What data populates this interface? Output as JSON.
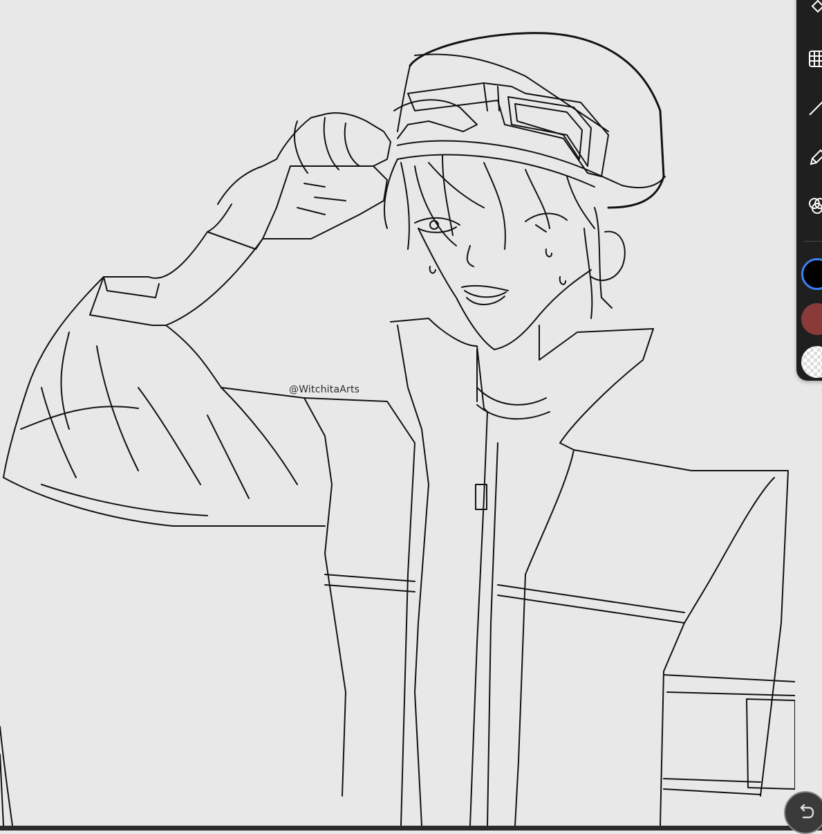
{
  "canvas": {
    "watermark": "@WitchitaArts"
  },
  "toolbar": {
    "tools": [
      "paint-bucket-icon",
      "grid-icon",
      "line-icon",
      "pen-icon",
      "blend-icon"
    ],
    "swatches": [
      {
        "name": "primary-color",
        "color": "#000000",
        "selected": true
      },
      {
        "name": "secondary-color",
        "color": "#8b3a3a",
        "selected": false
      },
      {
        "name": "transparent-color",
        "color": "#ffffff",
        "selected": false
      }
    ],
    "accent": "#3b82f6"
  },
  "corner_button": {
    "icon": "undo-icon"
  }
}
